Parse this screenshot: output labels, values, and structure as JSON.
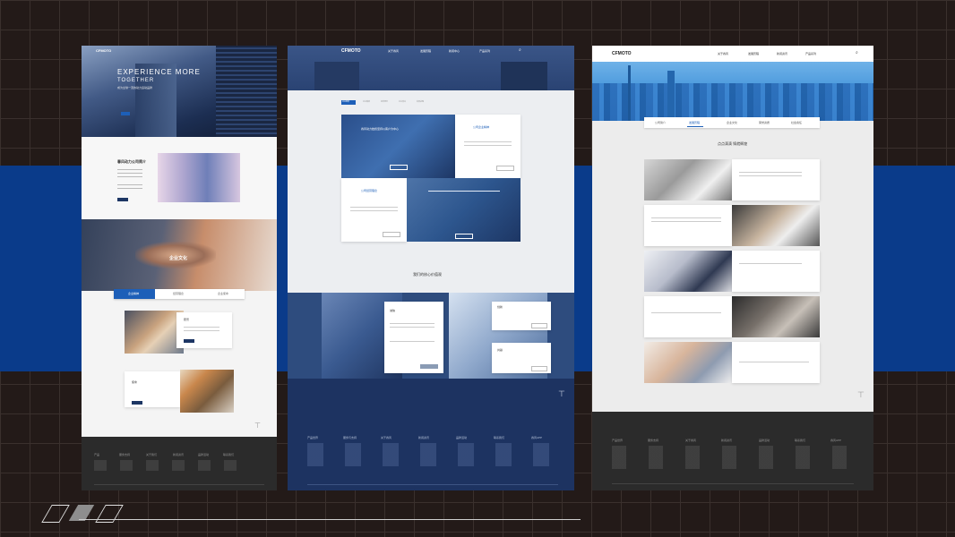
{
  "colors": {
    "background": "#231a18",
    "band": "#0a3b8a",
    "accent": "#1d5fb8",
    "navy": "#1d3664",
    "footer_dark": "#2a2a2a"
  },
  "screen1": {
    "logo": "CFMOTO",
    "hero_title": "EXPERIENCE MORE",
    "hero_subtitle": "TOGETHER",
    "hero_tagline": "成为全球一流的动力运动品牌",
    "intro_title": "春风动力公司简介",
    "culture_title": "企业文化",
    "tabs": [
      "企业精神",
      "经营理念",
      "企业使命"
    ],
    "cards": [
      "愿景",
      "使命"
    ],
    "footer_headings": [
      "产品",
      "服务支持",
      "关于我们",
      "新闻资讯",
      "品牌活动",
      "联系我们"
    ]
  },
  "screen2": {
    "logo": "CFMOTO",
    "nav": [
      "关于春风",
      "发展历程",
      "新闻中心",
      "产品系列"
    ],
    "tabs": [
      "企业愿景",
      "企业精神",
      "经营理念",
      "企业使命",
      "发展战略"
    ],
    "tile1_text": "春风动力始终坚持以客户为中心",
    "tile2_title": "公司企业精神",
    "tile3_title": "公司经营理念",
    "section_title": "我们的核心价值观",
    "value_card_title": "诚信",
    "side_card1": "创新",
    "side_card2": "共赢",
    "footer_headings": [
      "产品世界",
      "服务与支持",
      "关于春风",
      "新闻资讯",
      "品牌活动",
      "联系我们",
      "春风APP"
    ]
  },
  "screen3": {
    "logo": "CFMOTO",
    "nav": [
      "关于春风",
      "发展历程",
      "新闻资讯",
      "产品系列"
    ],
    "tabs": [
      "公司简介",
      "发展历程",
      "企业文化",
      "荣誉资质",
      "社会责任"
    ],
    "section_title": "点点滴滴  铸就辉煌",
    "footer_headings": [
      "产品世界",
      "服务支持",
      "关于春风",
      "新闻资讯",
      "品牌活动",
      "联系我们",
      "春风APP"
    ]
  }
}
